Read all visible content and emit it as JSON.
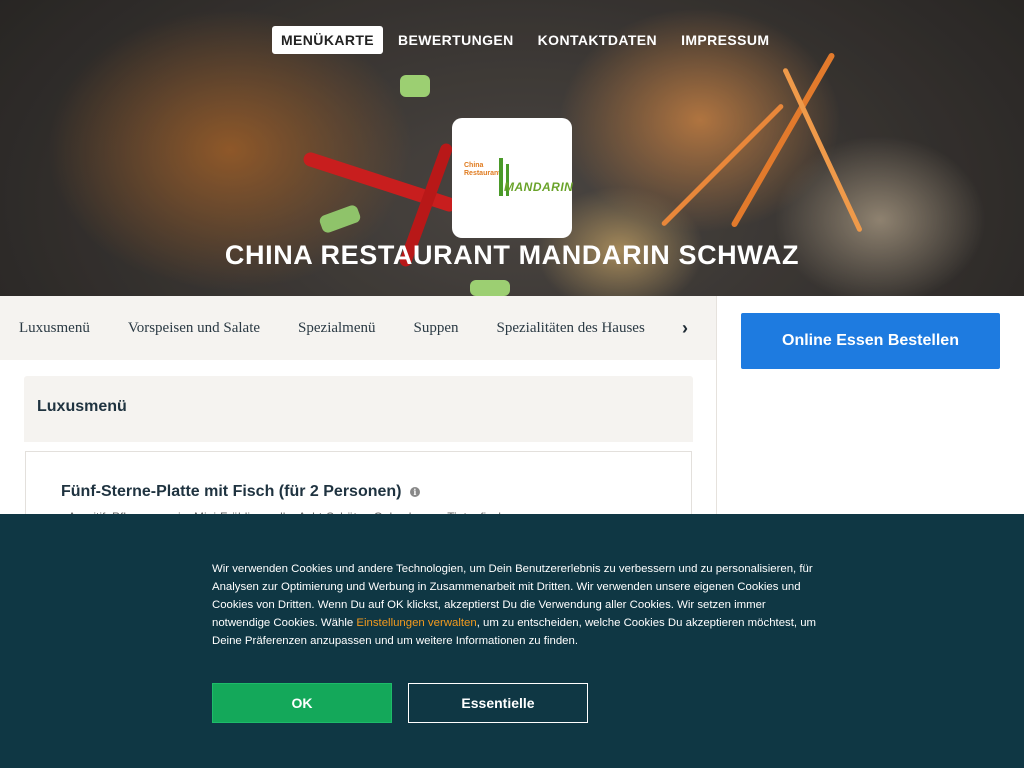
{
  "nav": {
    "items": [
      {
        "label": "MENÜKARTE",
        "active": true
      },
      {
        "label": "BEWERTUNGEN",
        "active": false
      },
      {
        "label": "KONTAKTDATEN",
        "active": false
      },
      {
        "label": "IMPRESSUM",
        "active": false
      }
    ]
  },
  "logo": {
    "line1": "China",
    "line2": "Restaurant",
    "brand": "MANDARIN"
  },
  "hero": {
    "title": "CHINA RESTAURANT MANDARIN SCHWAZ"
  },
  "categories": {
    "items": [
      "Luxusmenü",
      "Vorspeisen und Salate",
      "Spezialmenü",
      "Suppen",
      "Spezialitäten des Hauses"
    ],
    "next_icon": "chevron-right-icon"
  },
  "order": {
    "button_label": "Online Essen Bestellen"
  },
  "menu": {
    "section_title": "Luxusmenü",
    "dish": {
      "title": "Fünf-Sterne-Platte mit Fisch (für 2 Personen)",
      "info_icon": "i",
      "description": "Aperitif, Pflaumenwein, Mini-Frühlingsrolle, Acht-Schätze-Gebackenes, Tintenfisch"
    }
  },
  "cookie": {
    "text_before": "Wir verwenden Cookies und andere Technologien, um Dein Benutzererlebnis zu verbessern und zu personalisieren, für Analysen zur Optimierung und Werbung in Zusammenarbeit mit Dritten. Wir verwenden unsere eigenen Cookies und Cookies von Dritten. Wenn Du auf OK klickst, akzeptierst Du die Verwendung aller Cookies. Wir setzen immer notwendige Cookies. Wähle ",
    "link": "Einstellungen verwalten",
    "text_after": ", um zu entscheiden, welche Cookies Du akzeptieren möchtest, um Deine Präferenzen anzupassen und um weitere Informationen zu finden.",
    "ok_label": "OK",
    "essential_label": "Essentielle"
  },
  "colors": {
    "primary_blue": "#1e7be0",
    "cookie_bg": "#0f3744",
    "ok_green": "#14a85a",
    "link_orange": "#f39a1e"
  }
}
